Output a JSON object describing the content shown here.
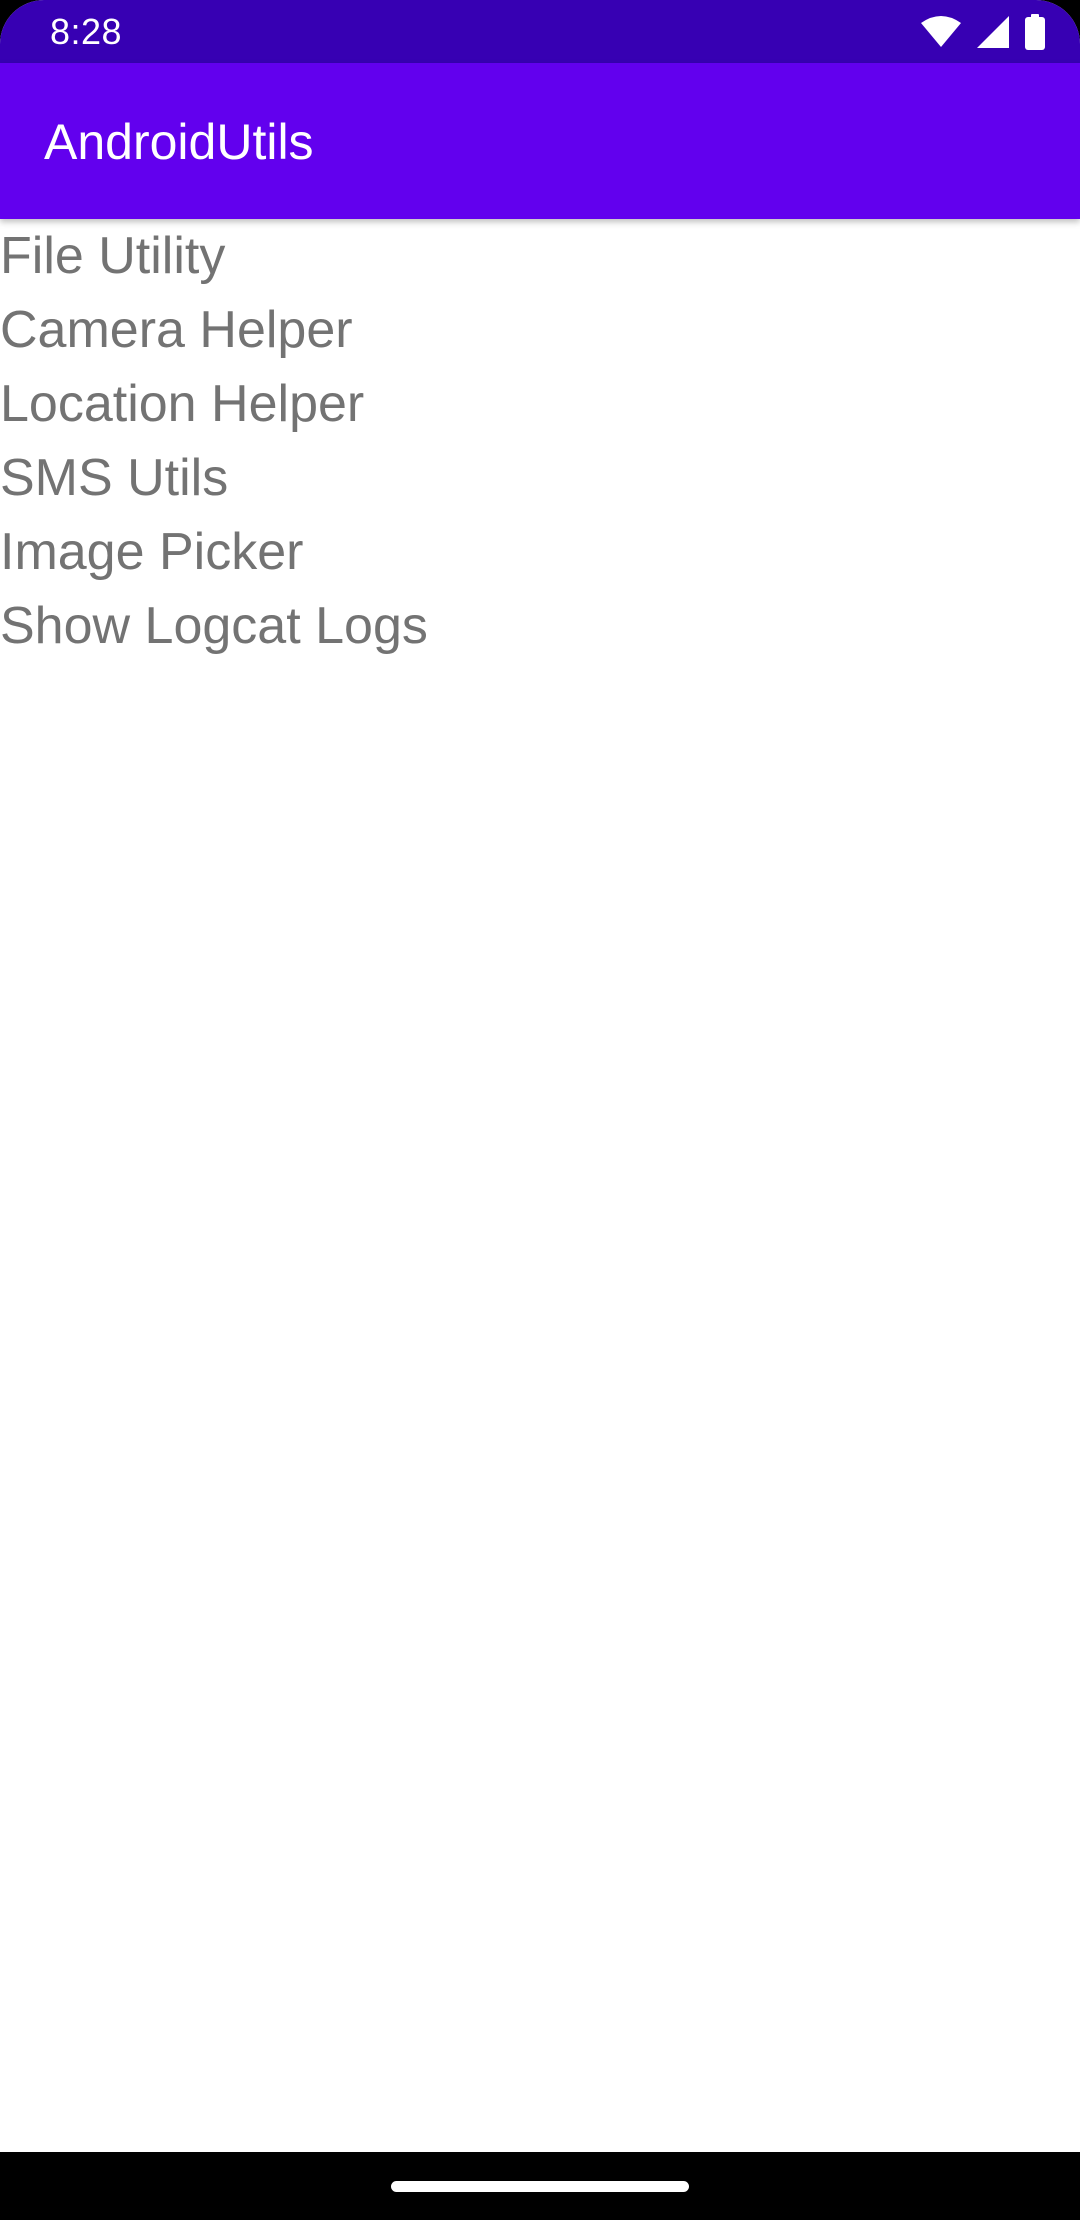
{
  "status_bar": {
    "time": "8:28",
    "icons": [
      "wifi-icon",
      "cellular-signal-icon",
      "battery-icon"
    ],
    "background_color": "#3700b3"
  },
  "app_bar": {
    "title": "AndroidUtils",
    "background_color": "#6200ee"
  },
  "menu": {
    "items": [
      {
        "label": "File Utility"
      },
      {
        "label": "Camera Helper"
      },
      {
        "label": "Location Helper"
      },
      {
        "label": "SMS Utils"
      },
      {
        "label": "Image Picker"
      },
      {
        "label": "Show Logcat Logs"
      }
    ],
    "text_color": "#737373"
  },
  "navigation_bar": {
    "icons": [
      "home-handle"
    ]
  }
}
